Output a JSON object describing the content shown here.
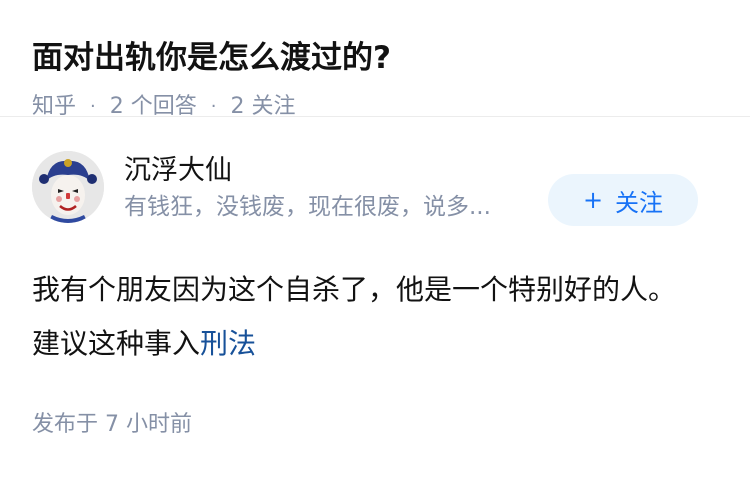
{
  "question": {
    "title": "面对出轨你是怎么渡过的?",
    "meta": {
      "source": "知乎",
      "answers": "2 个回答",
      "followers": "2 关注",
      "separator": "·"
    }
  },
  "answer": {
    "author": {
      "name": "沉浮大仙",
      "bio": "有钱狂，没钱废，现在很废，说多...",
      "avatar_icon": "masked-character-avatar"
    },
    "follow_button": {
      "plus": "+",
      "label": "关注"
    },
    "content": {
      "text": "我有个朋友因为这个自杀了，他是一个特别好的人。建议这种事入",
      "link_text": "刑法"
    },
    "footer": {
      "time": "发布于 7 小时前"
    }
  },
  "colors": {
    "meta_gray": "#8590a6",
    "link_blue": "#175199",
    "button_blue": "#1772f6",
    "button_bg": "#ebf5fd"
  }
}
